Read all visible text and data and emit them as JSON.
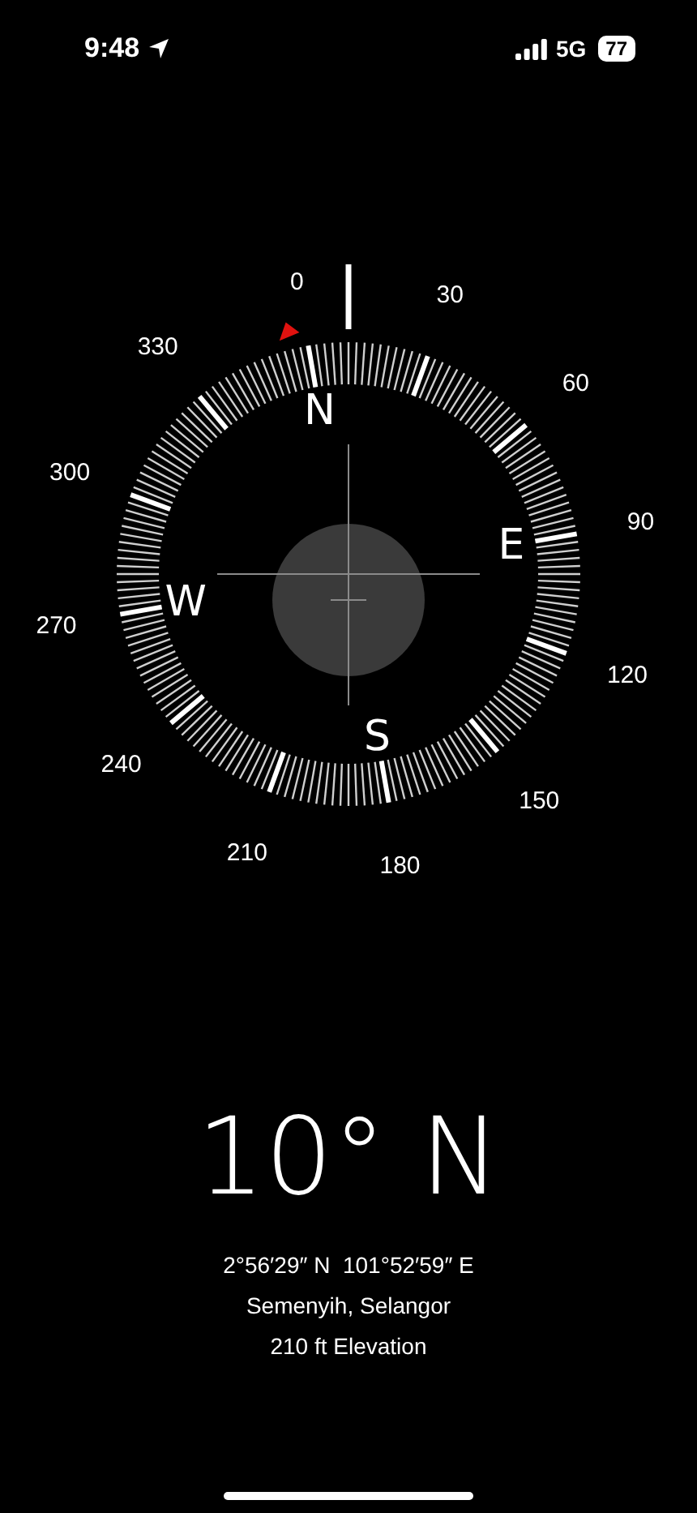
{
  "status_bar": {
    "time": "9:48",
    "network": "5G",
    "battery": "77"
  },
  "compass": {
    "degree_labels": [
      "0",
      "30",
      "60",
      "90",
      "120",
      "150",
      "180",
      "210",
      "240",
      "270",
      "300",
      "330"
    ],
    "cardinals": [
      "N",
      "E",
      "S",
      "W"
    ]
  },
  "readout": {
    "heading": "10° N",
    "coordinates": "2°56′29″ N  101°52′59″ E",
    "place": "Semenyih, Selangor",
    "elevation": "210 ft Elevation"
  }
}
